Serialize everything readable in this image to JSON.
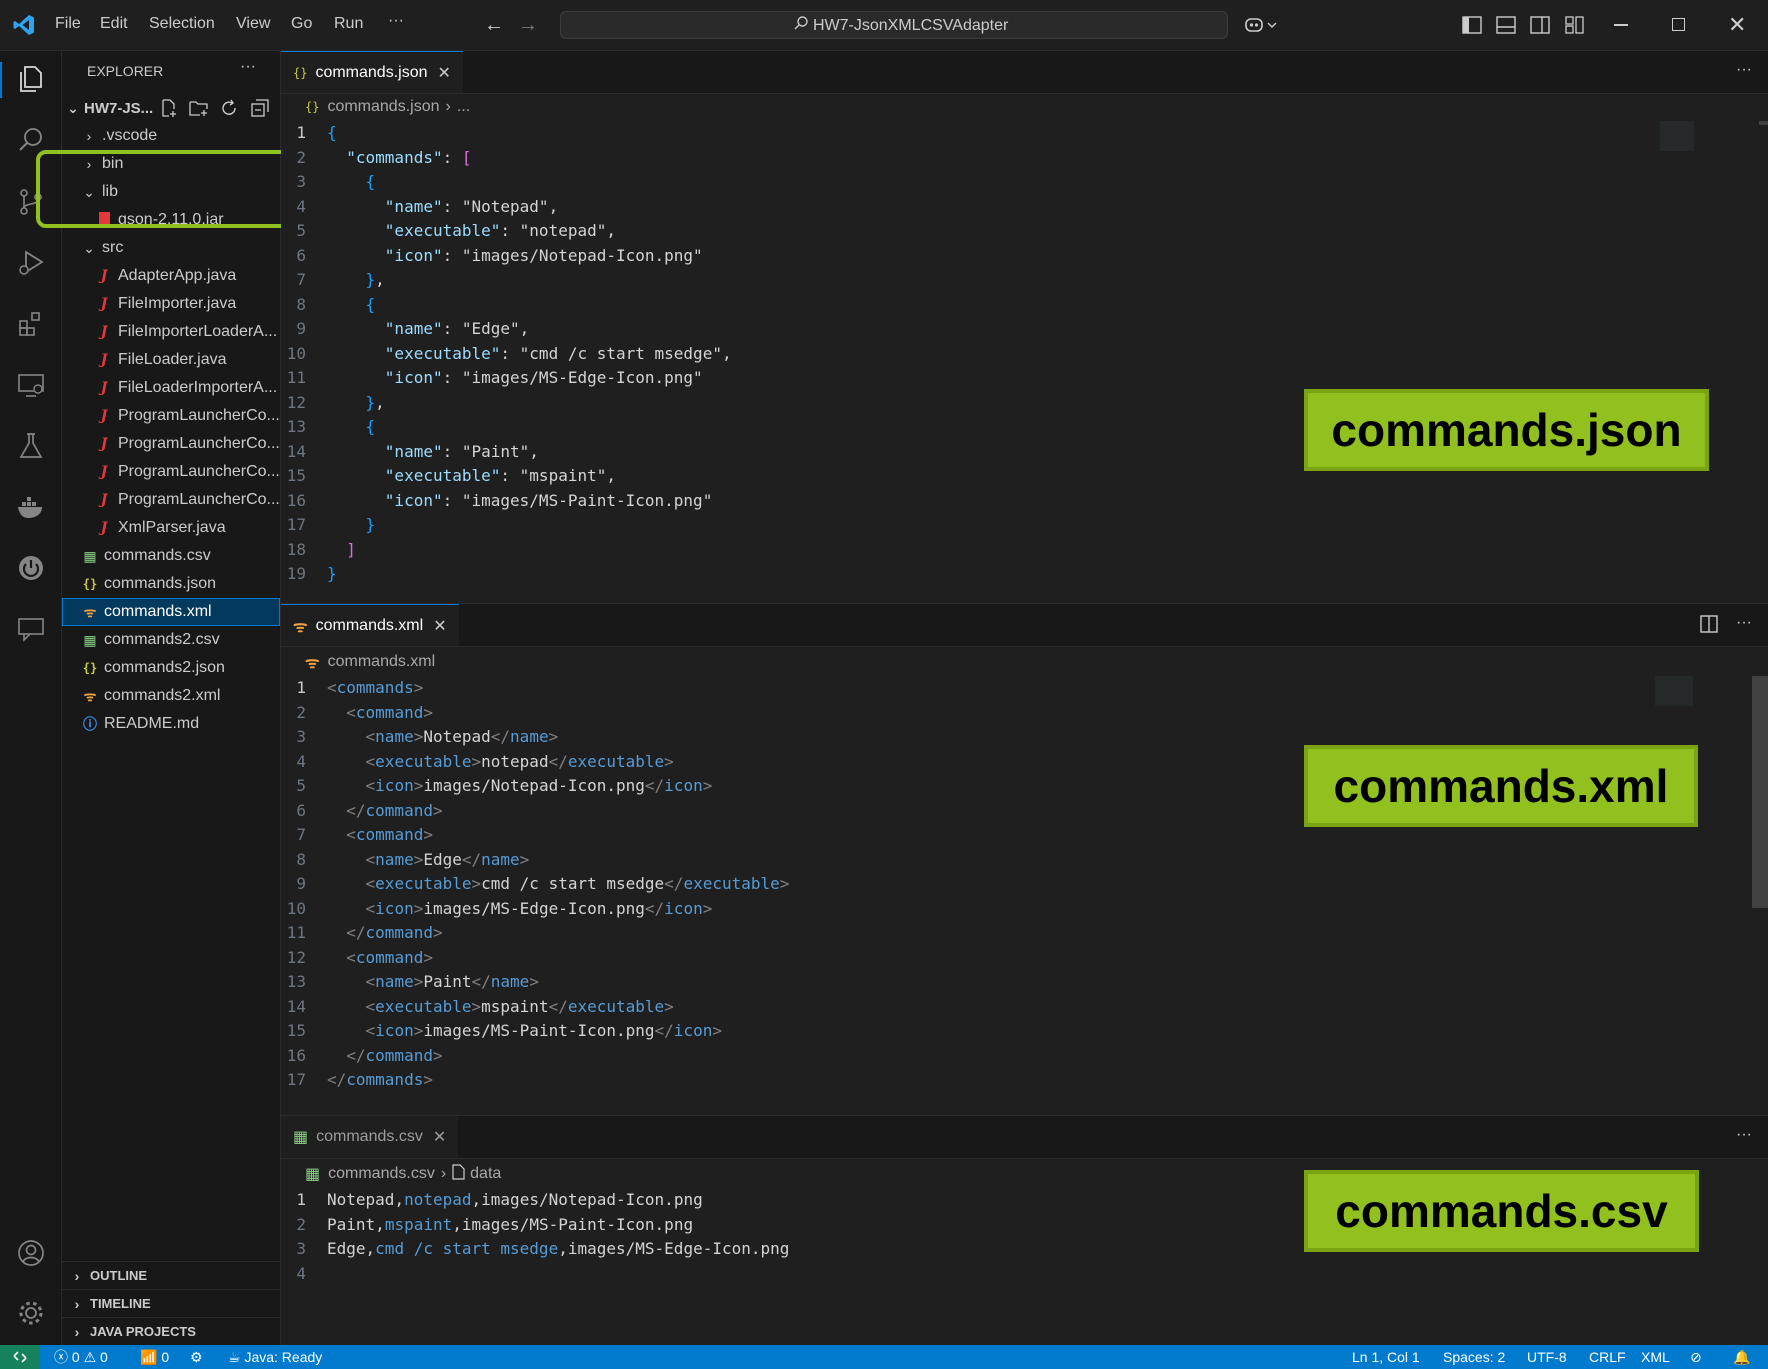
{
  "titlebar": {
    "menu": [
      "File",
      "Edit",
      "Selection",
      "View",
      "Go",
      "Run",
      "···"
    ],
    "search_text": "HW7-JsonXMLCSVAdapter"
  },
  "sidebar": {
    "title": "EXPLORER",
    "more": "···",
    "root": "HW7-JS...",
    "tree": [
      {
        "label": ".vscode",
        "type": "folder",
        "expanded": false
      },
      {
        "label": "bin",
        "type": "folder",
        "expanded": false
      },
      {
        "label": "lib",
        "type": "folder",
        "expanded": true
      },
      {
        "label": "gson-2.11.0.jar",
        "type": "jar"
      },
      {
        "label": "src",
        "type": "folder",
        "expanded": true
      },
      {
        "label": "AdapterApp.java",
        "type": "java"
      },
      {
        "label": "FileImporter.java",
        "type": "java"
      },
      {
        "label": "FileImporterLoaderA...",
        "type": "java"
      },
      {
        "label": "FileLoader.java",
        "type": "java"
      },
      {
        "label": "FileLoaderImporterA...",
        "type": "java"
      },
      {
        "label": "ProgramLauncherCo...",
        "type": "java"
      },
      {
        "label": "ProgramLauncherCo...",
        "type": "java"
      },
      {
        "label": "ProgramLauncherCo...",
        "type": "java"
      },
      {
        "label": "ProgramLauncherCo...",
        "type": "java"
      },
      {
        "label": "XmlParser.java",
        "type": "java"
      },
      {
        "label": "commands.csv",
        "type": "csv"
      },
      {
        "label": "commands.json",
        "type": "json"
      },
      {
        "label": "commands.xml",
        "type": "xml",
        "selected": true
      },
      {
        "label": "commands2.csv",
        "type": "csv"
      },
      {
        "label": "commands2.json",
        "type": "json"
      },
      {
        "label": "commands2.xml",
        "type": "xml"
      },
      {
        "label": "README.md",
        "type": "info"
      }
    ],
    "sections": [
      "OUTLINE",
      "TIMELINE",
      "JAVA PROJECTS"
    ]
  },
  "editors": {
    "json": {
      "tab": "commands.json",
      "breadcrumb_file": "commands.json",
      "breadcrumb_rest": "...",
      "label": "commands.json",
      "lines": [
        "{",
        "  \"commands\": [",
        "    {",
        "      \"name\": \"Notepad\",",
        "      \"executable\": \"notepad\",",
        "      \"icon\": \"images/Notepad-Icon.png\"",
        "    },",
        "    {",
        "      \"name\": \"Edge\",",
        "      \"executable\": \"cmd /c start msedge\",",
        "      \"icon\": \"images/MS-Edge-Icon.png\"",
        "    },",
        "    {",
        "      \"name\": \"Paint\",",
        "      \"executable\": \"mspaint\",",
        "      \"icon\": \"images/MS-Paint-Icon.png\"",
        "    }",
        "  ]",
        "}"
      ]
    },
    "xml": {
      "tab": "commands.xml",
      "breadcrumb_file": "commands.xml",
      "label": "commands.xml",
      "lines": [
        "<commands>",
        "  <command>",
        "    <name>Notepad</name>",
        "    <executable>notepad</executable>",
        "    <icon>images/Notepad-Icon.png</icon>",
        "  </command>",
        "  <command>",
        "    <name>Edge</name>",
        "    <executable>cmd /c start msedge</executable>",
        "    <icon>images/MS-Edge-Icon.png</icon>",
        "  </command>",
        "  <command>",
        "    <name>Paint</name>",
        "    <executable>mspaint</executable>",
        "    <icon>images/MS-Paint-Icon.png</icon>",
        "  </command>",
        "</commands>"
      ]
    },
    "csv": {
      "tab": "commands.csv",
      "breadcrumb_file": "commands.csv",
      "breadcrumb_rest": "data",
      "label": "commands.csv",
      "lines": [
        "Notepad,notepad,images/Notepad-Icon.png",
        "Paint,mspaint,images/MS-Paint-Icon.png",
        "Edge,cmd /c start msedge,images/MS-Edge-Icon.png",
        ""
      ]
    }
  },
  "statusbar": {
    "errors": "0",
    "warnings": "0",
    "ports": "0",
    "java": "Java: Ready",
    "position": "Ln 1, Col 1",
    "spaces": "Spaces: 2",
    "encoding": "UTF-8",
    "eol": "CRLF",
    "language": "XML"
  },
  "colors": {
    "accent": "#007acc",
    "label_green": "#92c01f",
    "editor_bg": "#1f1f1f",
    "sidebar_bg": "#181818"
  }
}
